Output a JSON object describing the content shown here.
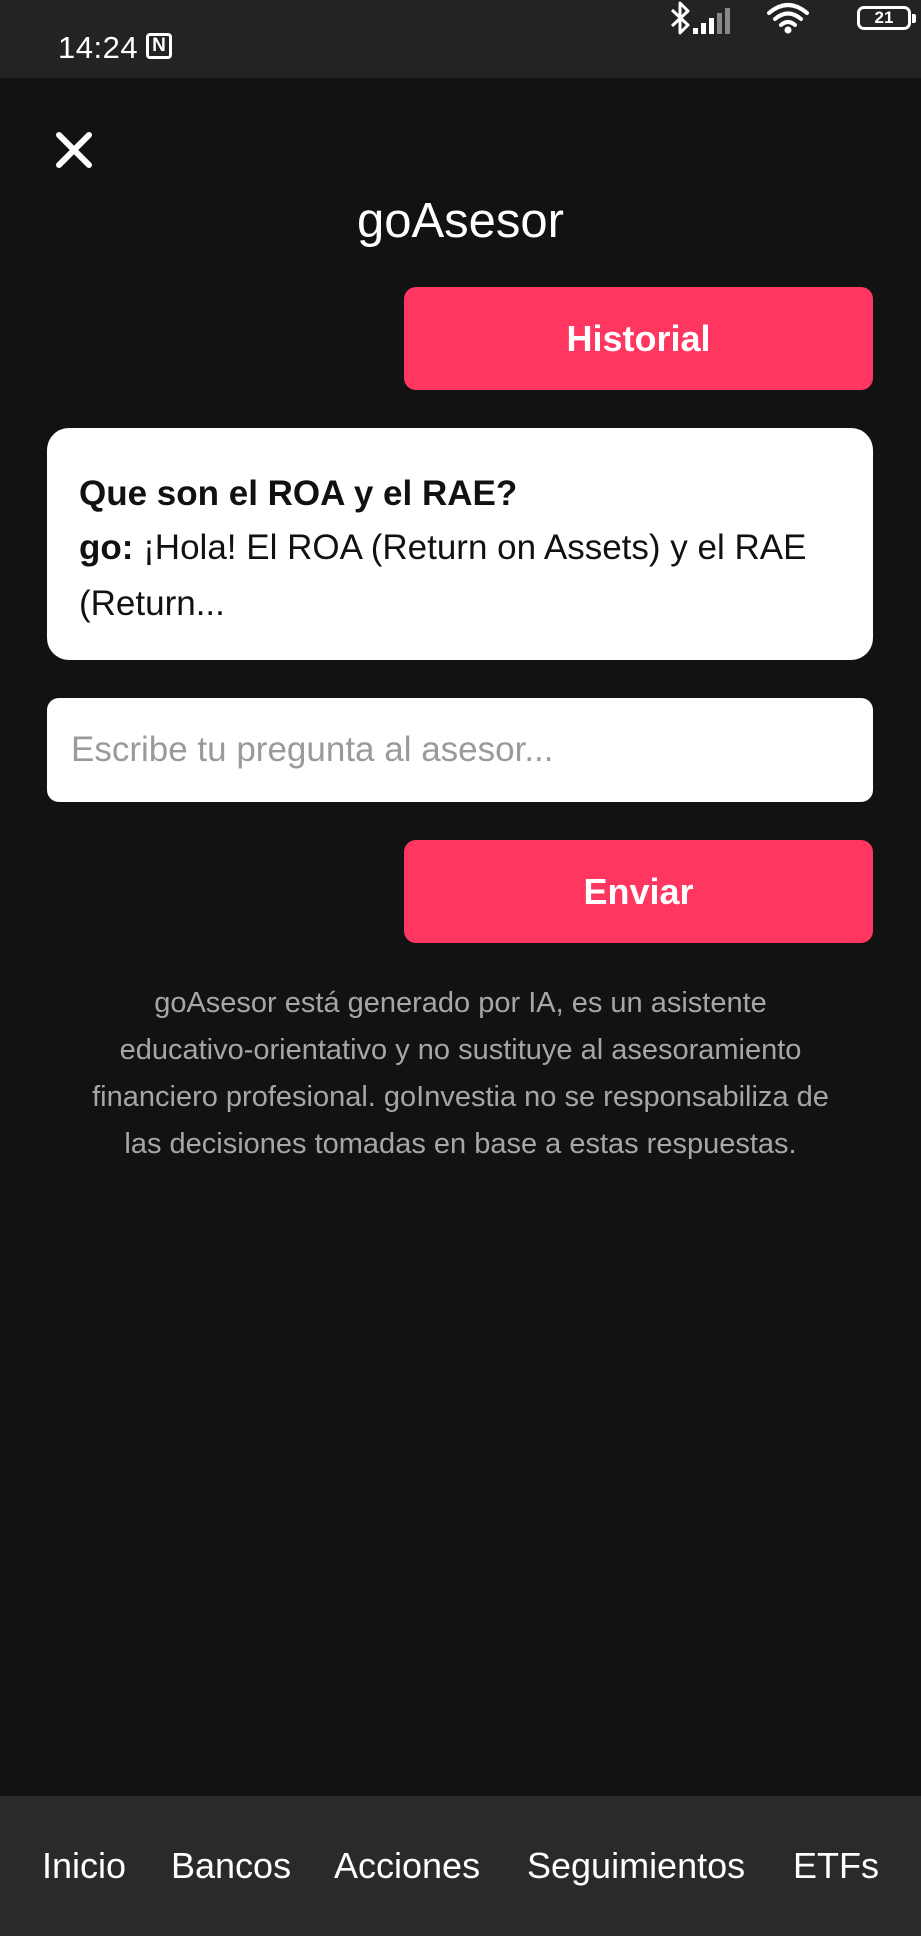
{
  "status_bar": {
    "time": "14:24",
    "nfc_symbol": "N",
    "battery_level": "21",
    "icons": [
      "nfc-icon",
      "bluetooth-icon",
      "signal-icon",
      "wifi-icon",
      "battery-icon"
    ]
  },
  "header": {
    "close_icon": "close-icon",
    "title": "goAsesor"
  },
  "actions": {
    "history_label": "Historial",
    "send_label": "Enviar"
  },
  "chat_preview": {
    "question": "Que son el ROA y el RAE?",
    "answer_prefix": "go:",
    "answer_text": " ¡Hola! El ROA (Return on Assets) y el RAE (Return..."
  },
  "input": {
    "value": "",
    "placeholder": "Escribe tu pregunta al asesor..."
  },
  "disclaimer": "goAsesor está generado por IA, es un asistente educativo-orientativo y no sustituye al asesoramiento financiero profesional. goInvestia no se responsabiliza de las decisiones tomadas en base a estas respuestas.",
  "bottom_nav": {
    "items": [
      {
        "label": "Inicio"
      },
      {
        "label": "Bancos"
      },
      {
        "label": "Acciones"
      },
      {
        "label": "Seguimientos"
      },
      {
        "label": "ETFs"
      }
    ]
  },
  "colors": {
    "accent": "#ff3760",
    "background": "#121212",
    "status_bar": "#232323",
    "bottom_nav": "#2a2a2a",
    "card": "#ffffff",
    "disclaimer_text": "#a6a6a6"
  }
}
